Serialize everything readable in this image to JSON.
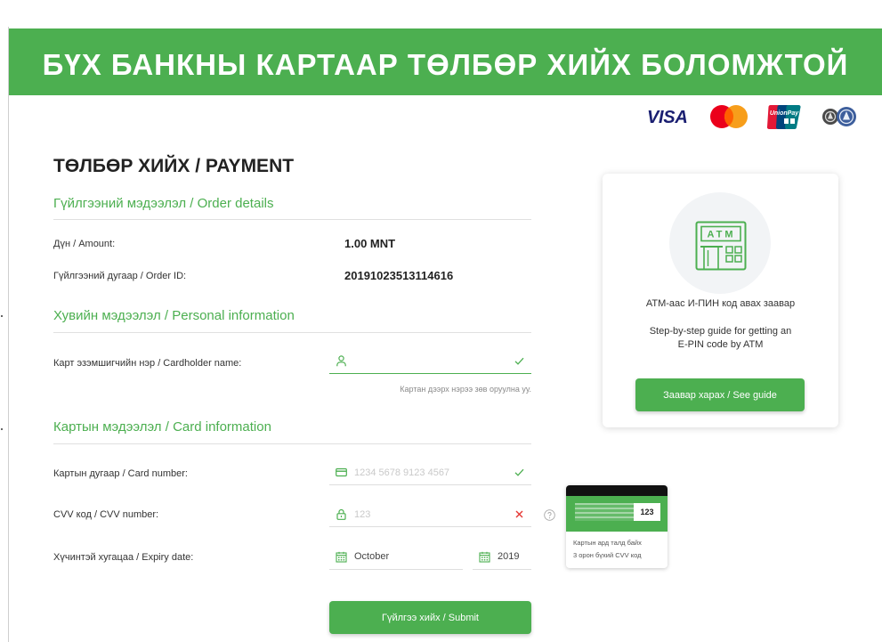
{
  "theme": {
    "accent": "#4caf50",
    "error": "#e53935",
    "text": "#222222"
  },
  "banner": {
    "title": "БҮХ БАНКНЫ КАРТААР ТӨЛБӨР ХИЙХ БОЛОМЖТОЙ"
  },
  "brands": {
    "visa": "VISA",
    "mastercard_icon": "mastercard-logo",
    "unionpay": "UnionPay",
    "unionpay_cn": "银联",
    "local_network_icon": "bank-emblem-logo"
  },
  "page": {
    "title": "ТӨЛБӨР ХИЙХ / PAYMENT"
  },
  "order": {
    "heading": "Гүйлгээний мэдээлэл / Order details",
    "amount_label": "Дүн / Amount:",
    "amount_value": "1.00 MNT",
    "order_id_label": "Гүйлгээний дугаар / Order ID:",
    "order_id_value": "20191023513114616"
  },
  "personal": {
    "heading": "Хувийн мэдээлэл / Personal information",
    "cardholder_label": "Карт эзэмшигчийн нэр / Cardholder name:",
    "cardholder_icon": "user-icon",
    "cardholder_status_icon": "check-icon",
    "cardholder_hint": "Картан дээрх нэрээ зөв оруулна уу."
  },
  "card": {
    "heading": "Картын мэдээлэл / Card information",
    "number_label": "Картын дугаар / Card number:",
    "number_placeholder": "1234 5678 9123 4567",
    "number_icon": "credit-card-icon",
    "number_status_icon": "check-icon",
    "cvv_label": "CVV код / CVV number:",
    "cvv_placeholder": "123",
    "cvv_icon": "lock-icon",
    "cvv_status_icon": "close-icon",
    "cvv_help_icon": "question-circle-icon",
    "expiry_label": "Хүчинтэй хугацаа / Expiry date:",
    "expiry_icon": "calendar-icon",
    "expiry_month": "October",
    "expiry_year": "2019"
  },
  "cvv_help": {
    "sample_code": "123",
    "line1": "Картын ард талд байх",
    "line2": "3 орон бүхий CVV код"
  },
  "submit": {
    "label": "Гүйлгээ хийх / Submit"
  },
  "guide": {
    "icon": "atm-icon",
    "icon_label": "ATM",
    "title": "АТМ-аас И-ПИН код авах заавар",
    "line1": "Step-by-step guide for getting an",
    "line2": "E-PIN code by ATM",
    "button": "Заавар харах / See guide"
  }
}
